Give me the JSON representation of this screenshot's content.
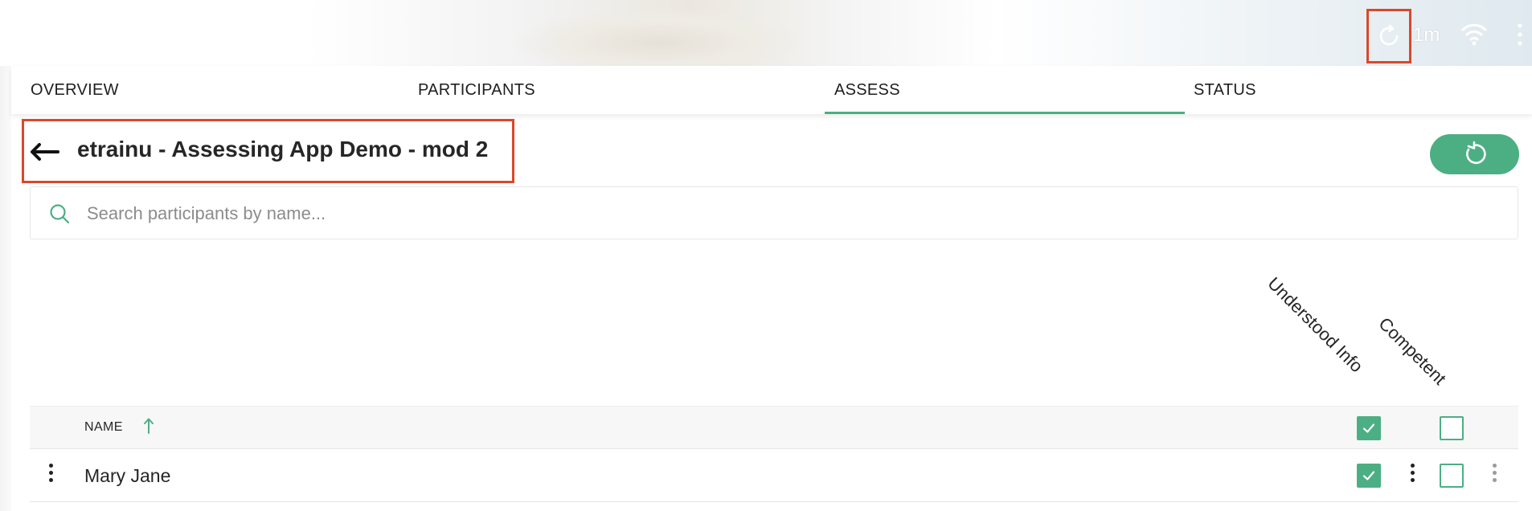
{
  "status": {
    "sync_age": "1m"
  },
  "tabs": [
    {
      "label": "OVERVIEW",
      "active": false
    },
    {
      "label": "PARTICIPANTS",
      "active": false
    },
    {
      "label": "ASSESS",
      "active": true
    },
    {
      "label": "STATUS",
      "active": false
    }
  ],
  "header": {
    "title": "etrainu - Assessing App Demo - mod 2"
  },
  "search": {
    "placeholder": "Search participants by name..."
  },
  "columns": {
    "understood": "Understood Info",
    "competent": "Competent"
  },
  "table": {
    "name_header": "NAME",
    "sort": "ascending",
    "select_all": {
      "understood": true,
      "competent": false
    },
    "rows": [
      {
        "name": "Mary Jane",
        "understood": true,
        "competent": false
      }
    ]
  },
  "colors": {
    "accent": "#4caf83",
    "highlight": "#d9482b"
  },
  "icons": [
    "sync-icon",
    "wifi-icon",
    "more-vertical-icon",
    "back-arrow-icon",
    "refresh-icon",
    "search-icon",
    "sort-arrow-up-icon",
    "checkmark-icon"
  ]
}
